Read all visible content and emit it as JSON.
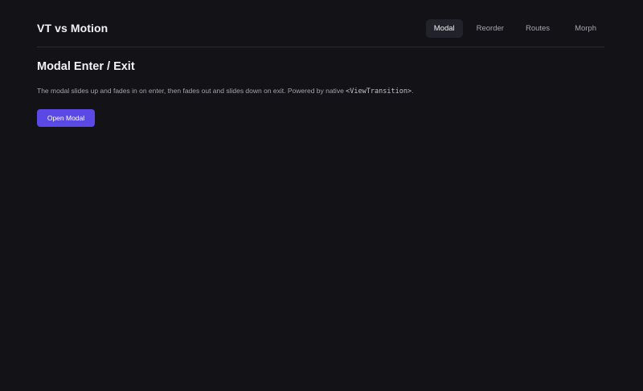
{
  "app": {
    "title": "VT vs Motion"
  },
  "nav": {
    "tabs": [
      {
        "label": "Modal",
        "active": true
      },
      {
        "label": "Reorder",
        "active": false
      },
      {
        "label": "Routes",
        "active": false
      },
      {
        "label": "Morph",
        "active": false
      }
    ]
  },
  "main": {
    "title": "Modal Enter / Exit",
    "description_before": "The modal slides up and fades in on enter, then fades out and slides down on exit. Powered by native ",
    "description_code": "<ViewTransition>",
    "description_after": ".",
    "button_label": "Open Modal"
  },
  "colors": {
    "background": "#121217",
    "accent": "#5b49e6",
    "active_tab_bg": "#22222a",
    "text_primary": "#f2f2f5",
    "text_muted": "#a3a3ad"
  }
}
